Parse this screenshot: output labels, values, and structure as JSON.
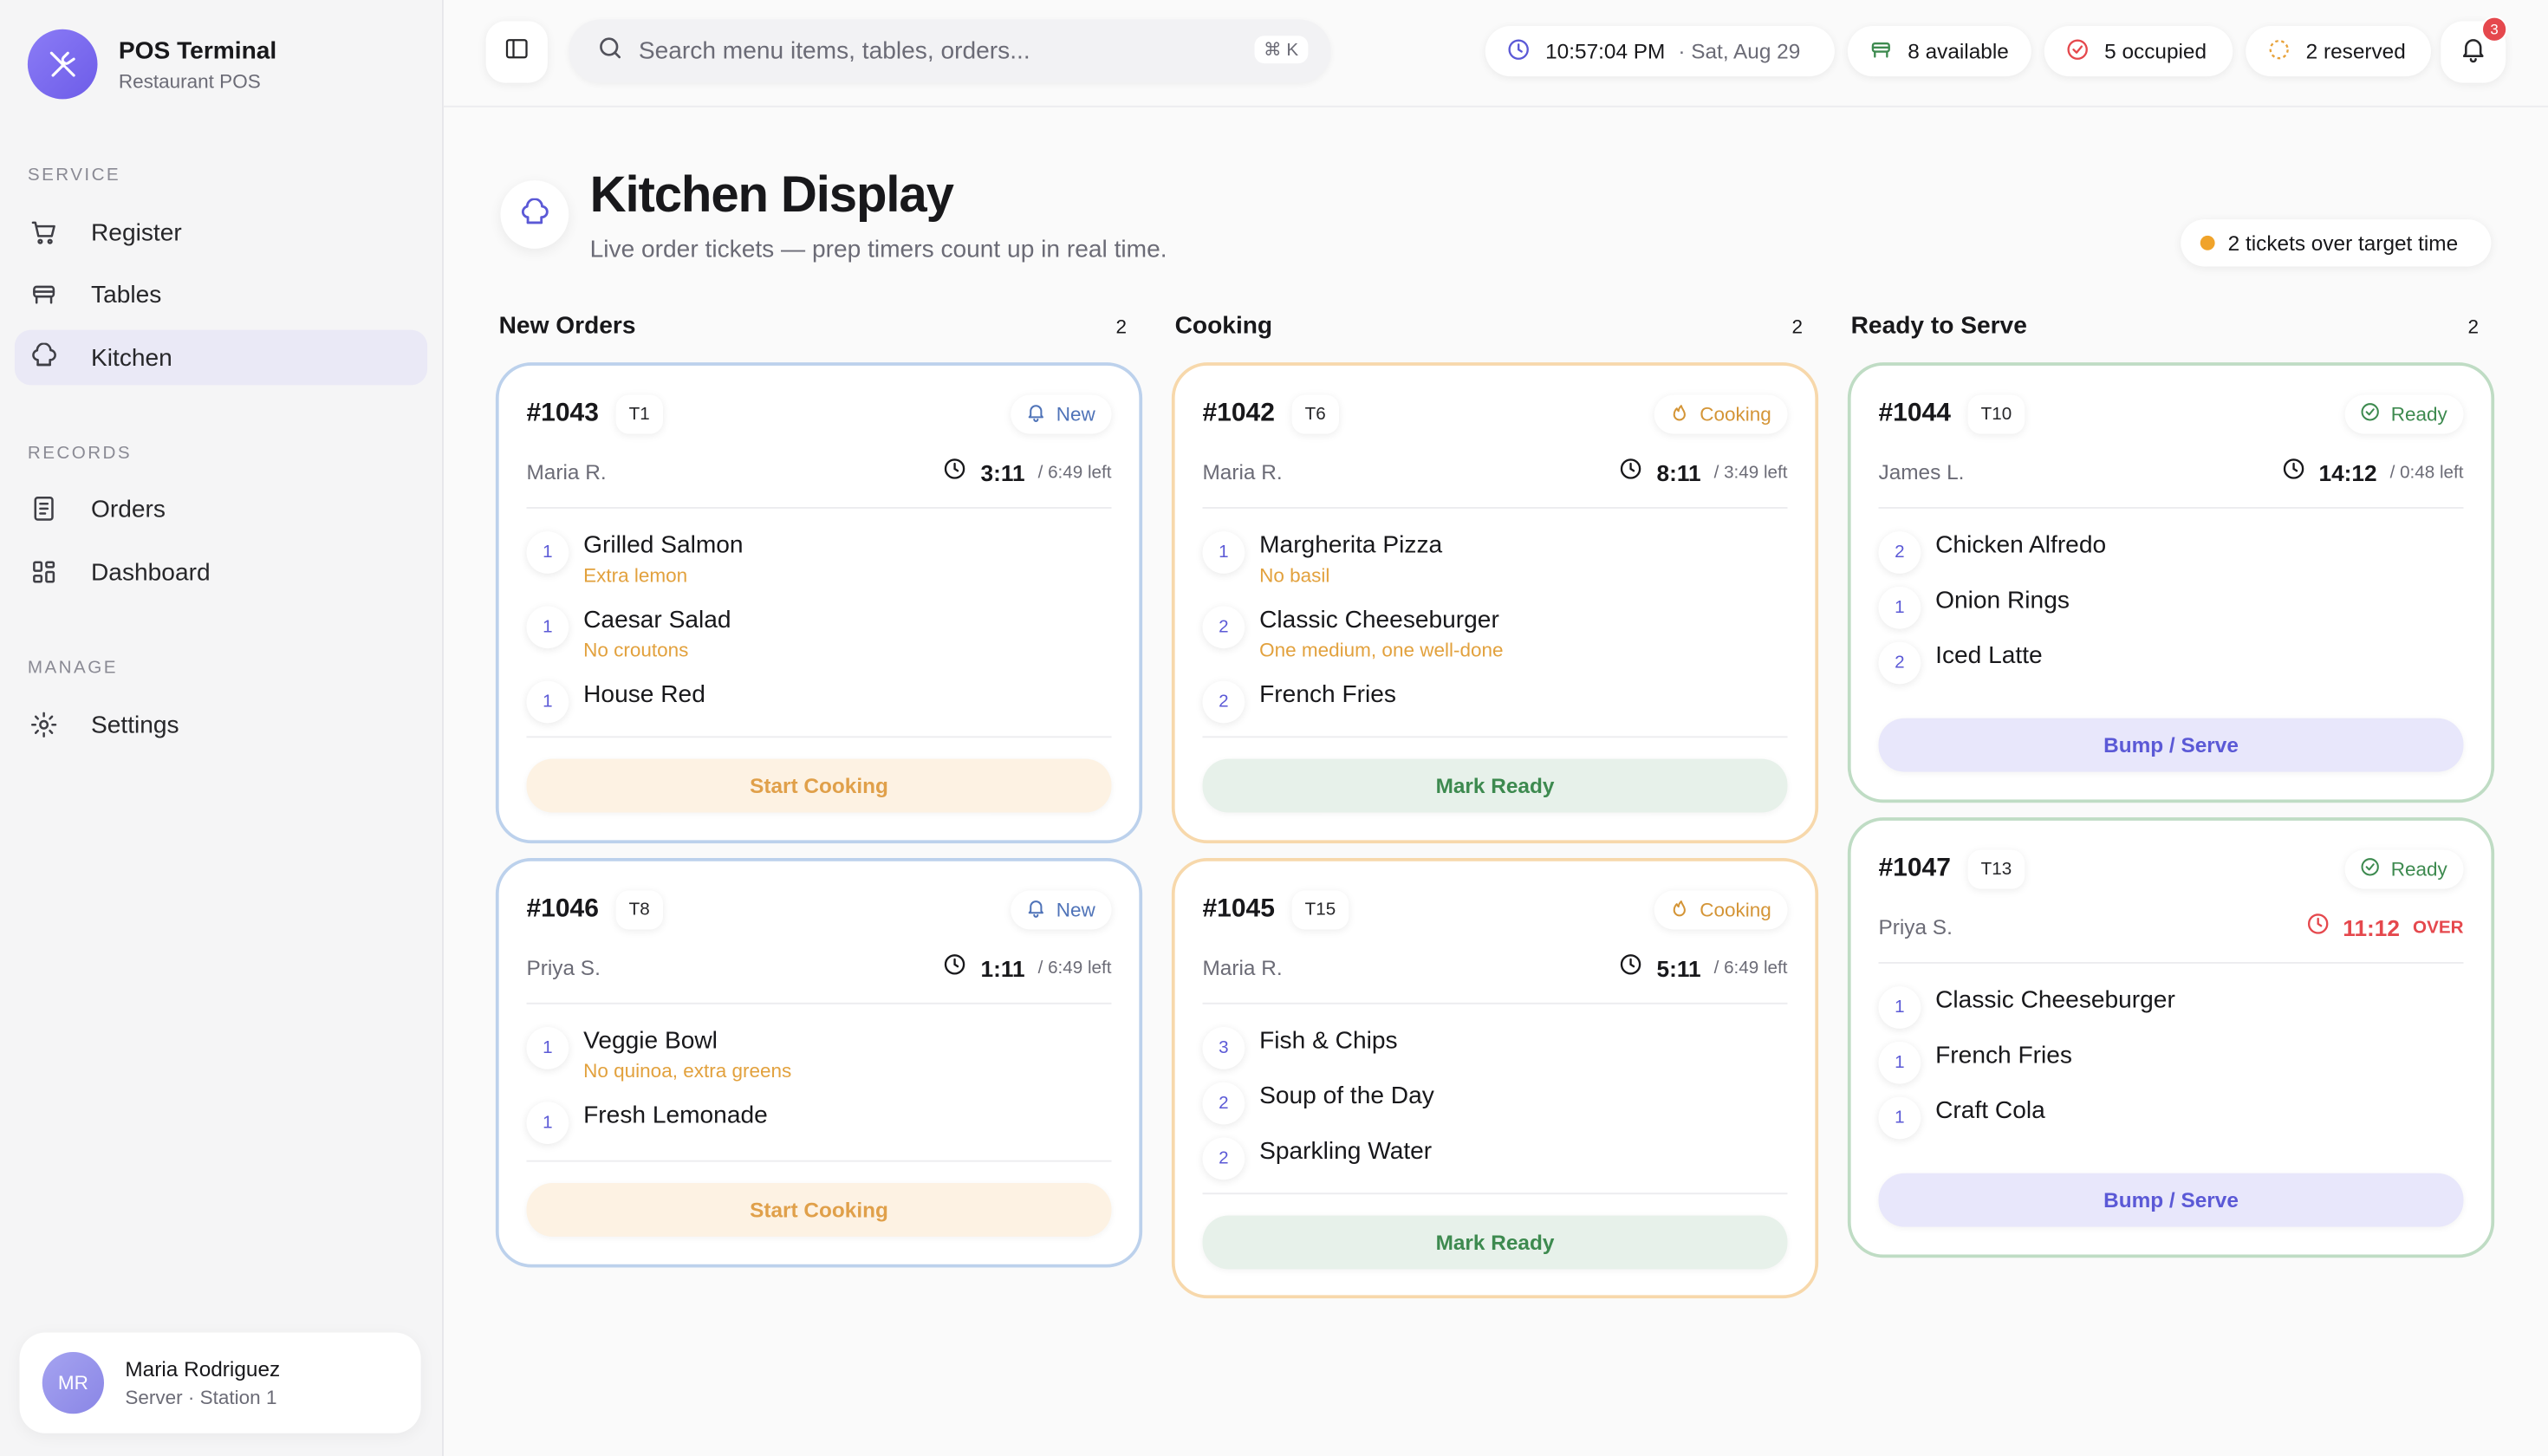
{
  "app": {
    "title": "POS Terminal",
    "subtitle": "Restaurant POS"
  },
  "sidebar": {
    "sections": [
      {
        "label": "SERVICE",
        "items": [
          {
            "label": "Register",
            "icon": "cart-icon"
          },
          {
            "label": "Tables",
            "icon": "table-icon"
          },
          {
            "label": "Kitchen",
            "icon": "chef-hat-icon",
            "active": true
          }
        ]
      },
      {
        "label": "RECORDS",
        "items": [
          {
            "label": "Orders",
            "icon": "receipt-icon"
          },
          {
            "label": "Dashboard",
            "icon": "grid-icon"
          }
        ]
      },
      {
        "label": "MANAGE",
        "items": [
          {
            "label": "Settings",
            "icon": "gear-icon"
          }
        ]
      }
    ],
    "user": {
      "initials": "MR",
      "name": "Maria Rodriguez",
      "role": "Server · Station 1"
    }
  },
  "topbar": {
    "search_placeholder": "Search menu items, tables, orders...",
    "shortcut": "⌘ K",
    "clock": {
      "time": "10:57:04 PM",
      "date": "· Sat, Aug 29"
    },
    "available": "8 available",
    "occupied": "5 occupied",
    "reserved": "2 reserved",
    "notifications": "3"
  },
  "header": {
    "title": "Kitchen Display",
    "subtitle": "Live order tickets — prep timers count up in real time.",
    "over_target": "2 tickets over target time"
  },
  "columns": [
    {
      "title": "New Orders",
      "count": "2",
      "action_label": "Start Cooking",
      "tickets": [
        {
          "id": "#1043",
          "table": "T1",
          "status": "New",
          "server": "Maria R.",
          "time": "3:11",
          "left": "/ 6:49 left",
          "over": false,
          "items": [
            {
              "qty": "1",
              "name": "Grilled Salmon",
              "note": "Extra lemon"
            },
            {
              "qty": "1",
              "name": "Caesar Salad",
              "note": "No croutons"
            },
            {
              "qty": "1",
              "name": "House Red",
              "note": ""
            }
          ]
        },
        {
          "id": "#1046",
          "table": "T8",
          "status": "New",
          "server": "Priya S.",
          "time": "1:11",
          "left": "/ 6:49 left",
          "over": false,
          "items": [
            {
              "qty": "1",
              "name": "Veggie Bowl",
              "note": "No quinoa, extra greens"
            },
            {
              "qty": "1",
              "name": "Fresh Lemonade",
              "note": ""
            }
          ]
        }
      ]
    },
    {
      "title": "Cooking",
      "count": "2",
      "action_label": "Mark Ready",
      "tickets": [
        {
          "id": "#1042",
          "table": "T6",
          "status": "Cooking",
          "server": "Maria R.",
          "time": "8:11",
          "left": "/ 3:49 left",
          "over": false,
          "items": [
            {
              "qty": "1",
              "name": "Margherita Pizza",
              "note": "No basil"
            },
            {
              "qty": "2",
              "name": "Classic Cheeseburger",
              "note": "One medium, one well-done"
            },
            {
              "qty": "2",
              "name": "French Fries",
              "note": ""
            }
          ]
        },
        {
          "id": "#1045",
          "table": "T15",
          "status": "Cooking",
          "server": "Maria R.",
          "time": "5:11",
          "left": "/ 6:49 left",
          "over": false,
          "items": [
            {
              "qty": "3",
              "name": "Fish & Chips",
              "note": ""
            },
            {
              "qty": "2",
              "name": "Soup of the Day",
              "note": ""
            },
            {
              "qty": "2",
              "name": "Sparkling Water",
              "note": ""
            }
          ]
        }
      ]
    },
    {
      "title": "Ready to Serve",
      "count": "2",
      "action_label": "Bump / Serve",
      "tickets": [
        {
          "id": "#1044",
          "table": "T10",
          "status": "Ready",
          "server": "James L.",
          "time": "14:12",
          "left": "/ 0:48 left",
          "over": false,
          "items": [
            {
              "qty": "2",
              "name": "Chicken Alfredo",
              "note": ""
            },
            {
              "qty": "1",
              "name": "Onion Rings",
              "note": ""
            },
            {
              "qty": "2",
              "name": "Iced Latte",
              "note": ""
            }
          ]
        },
        {
          "id": "#1047",
          "table": "T13",
          "status": "Ready",
          "server": "Priya S.",
          "time": "11:12",
          "left": "OVER",
          "over": true,
          "items": [
            {
              "qty": "1",
              "name": "Classic Cheeseburger",
              "note": ""
            },
            {
              "qty": "1",
              "name": "French Fries",
              "note": ""
            },
            {
              "qty": "1",
              "name": "Craft Cola",
              "note": ""
            }
          ]
        }
      ]
    }
  ]
}
